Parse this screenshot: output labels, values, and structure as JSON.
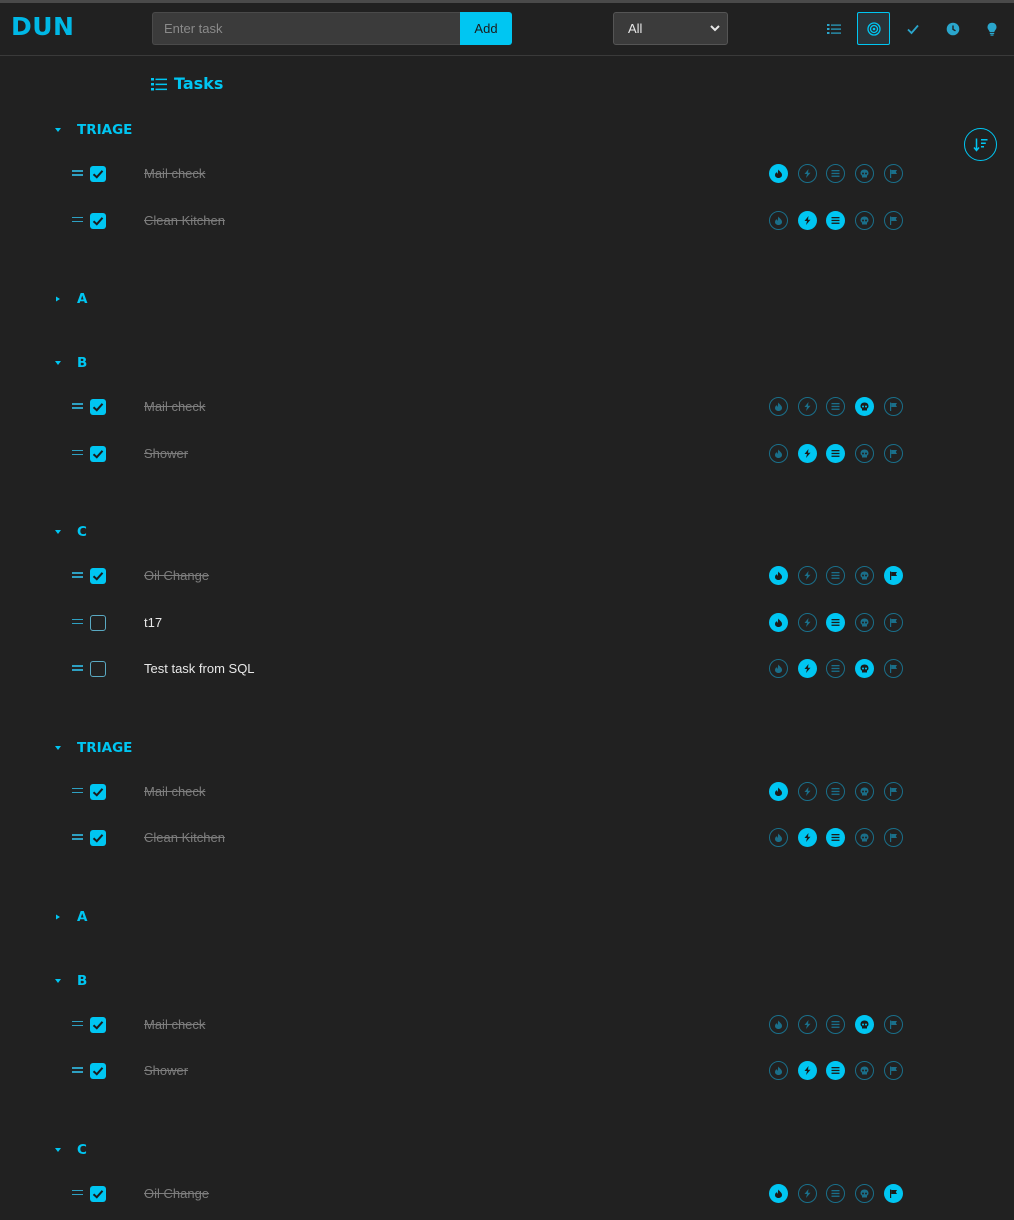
{
  "app": {
    "title": "DUN"
  },
  "header": {
    "input_placeholder": "Enter task",
    "add_label": "Add",
    "filter_value": "All",
    "nav": [
      {
        "icon": "list-icon",
        "active": false
      },
      {
        "icon": "target-icon",
        "active": true
      },
      {
        "icon": "check-icon",
        "active": false
      },
      {
        "icon": "clock-icon",
        "active": false
      },
      {
        "icon": "lightbulb-icon",
        "active": false
      }
    ]
  },
  "page": {
    "title": "Tasks",
    "sort_icon": "sort-descending-icon"
  },
  "tag_icons": [
    "fire-icon",
    "bolt-icon",
    "lines-icon",
    "skull-icon",
    "flag-icon"
  ],
  "colors": {
    "accent": "#00c6f2",
    "background": "#212121"
  },
  "groups": [
    {
      "name": "TRIAGE",
      "expanded": true,
      "tasks": [
        {
          "text": "Mail check",
          "done": true,
          "tags": [
            true,
            false,
            false,
            false,
            false
          ]
        },
        {
          "text": "Clean Kitchen",
          "done": true,
          "tags": [
            false,
            true,
            true,
            false,
            false
          ]
        }
      ]
    },
    {
      "name": "A",
      "expanded": false,
      "tasks": []
    },
    {
      "name": "B",
      "expanded": true,
      "tasks": [
        {
          "text": "Mail check",
          "done": true,
          "tags": [
            false,
            false,
            false,
            true,
            false
          ]
        },
        {
          "text": "Shower",
          "done": true,
          "tags": [
            false,
            true,
            true,
            false,
            false
          ]
        }
      ]
    },
    {
      "name": "C",
      "expanded": true,
      "tasks": [
        {
          "text": "Oil Change",
          "done": true,
          "tags": [
            true,
            false,
            false,
            false,
            true
          ]
        },
        {
          "text": "t17",
          "done": false,
          "tags": [
            true,
            false,
            true,
            false,
            false
          ]
        },
        {
          "text": "Test task from SQL",
          "done": false,
          "tags": [
            false,
            true,
            false,
            true,
            false
          ]
        }
      ]
    },
    {
      "name": "TRIAGE",
      "expanded": true,
      "tasks": [
        {
          "text": "Mail check",
          "done": true,
          "tags": [
            true,
            false,
            false,
            false,
            false
          ]
        },
        {
          "text": "Clean Kitchen",
          "done": true,
          "tags": [
            false,
            true,
            true,
            false,
            false
          ]
        }
      ]
    },
    {
      "name": "A",
      "expanded": false,
      "tasks": []
    },
    {
      "name": "B",
      "expanded": true,
      "tasks": [
        {
          "text": "Mail check",
          "done": true,
          "tags": [
            false,
            false,
            false,
            true,
            false
          ]
        },
        {
          "text": "Shower",
          "done": true,
          "tags": [
            false,
            true,
            true,
            false,
            false
          ]
        }
      ]
    },
    {
      "name": "C",
      "expanded": true,
      "tasks": [
        {
          "text": "Oil Change",
          "done": true,
          "tags": [
            true,
            false,
            false,
            false,
            true
          ]
        }
      ]
    }
  ]
}
